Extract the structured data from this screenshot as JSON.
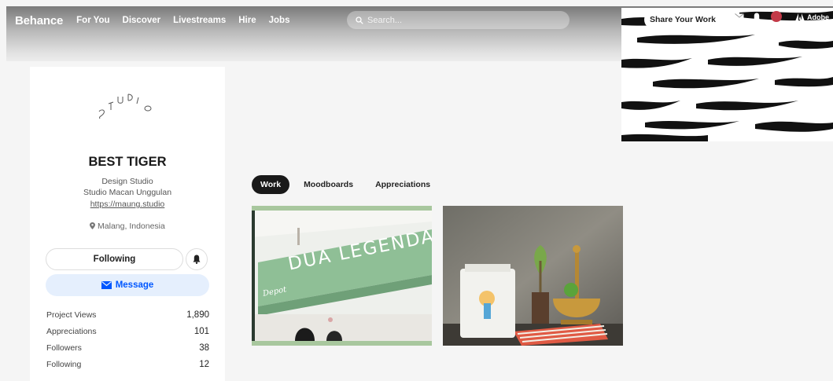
{
  "brand": {
    "logo": "Behance"
  },
  "nav": {
    "items": [
      "For You",
      "Discover",
      "Livestreams",
      "Hire",
      "Jobs"
    ]
  },
  "search": {
    "placeholder": "Search..."
  },
  "header": {
    "share_label": "Share Your Work",
    "adobe_label": "Adobe"
  },
  "profile": {
    "logo_text": "STUDIO",
    "name": "BEST TIGER",
    "type": "Design Studio",
    "tagline": "Studio Macan Unggulan",
    "website": "https://maung.studio",
    "location": "Malang, Indonesia",
    "following_label": "Following",
    "message_label": "Message",
    "stats": [
      {
        "label": "Project Views",
        "value": "1,890"
      },
      {
        "label": "Appreciations",
        "value": "101"
      },
      {
        "label": "Followers",
        "value": "38"
      },
      {
        "label": "Following",
        "value": "12"
      }
    ]
  },
  "tabs": [
    "Work",
    "Moodboards",
    "Appreciations"
  ],
  "projects": [
    {
      "image_text": "DUA LEGENDA",
      "image_text_small": "Depot"
    },
    {
      "image_text": ""
    }
  ],
  "colors": {
    "accent": "#0057ff",
    "message_bg": "#e5effd",
    "tab_active": "#191919"
  }
}
